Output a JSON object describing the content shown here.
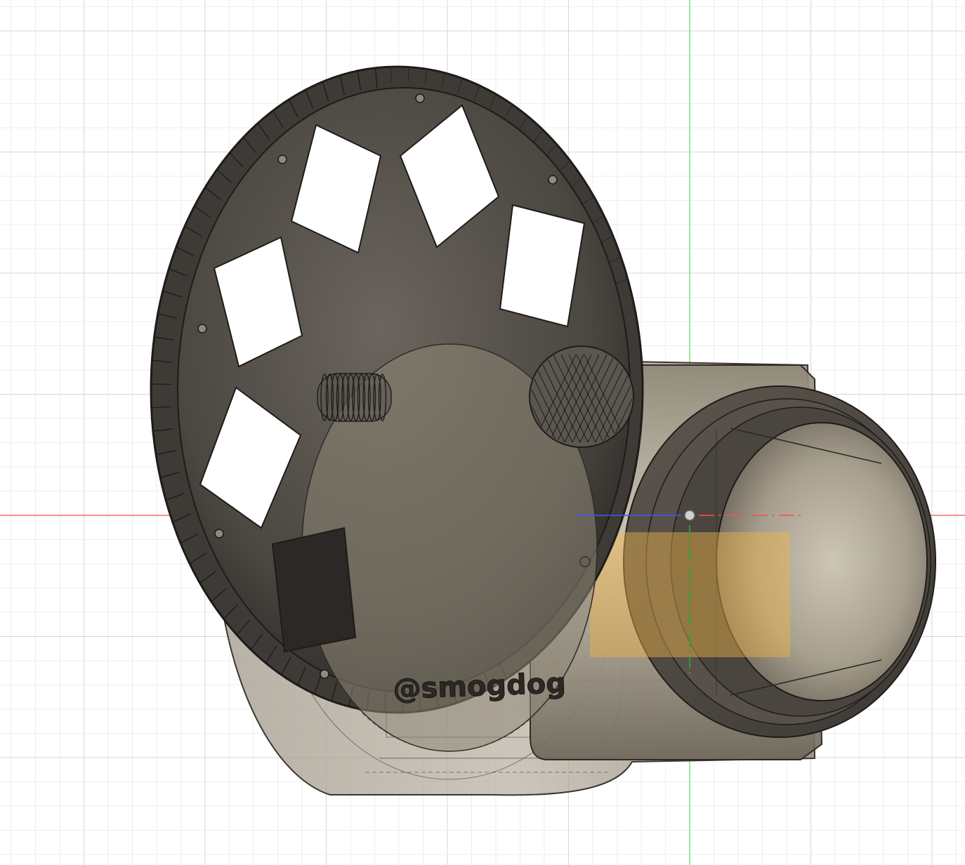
{
  "viewport": {
    "background": "#ffffff",
    "grid_minor_color": "#eeeeee",
    "grid_major_color": "#d6d6d6",
    "x_axis_color": "#ff4d4d",
    "y_axis_color": "#59d959",
    "z_axis_color": "#3a57ff"
  },
  "model": {
    "engraved_text": "@smogdog",
    "body_color": "#7d7466",
    "wheel_color": "#4e4a44",
    "lens_color": "#8a8270",
    "selection_highlight_color": "#f0b34a"
  }
}
